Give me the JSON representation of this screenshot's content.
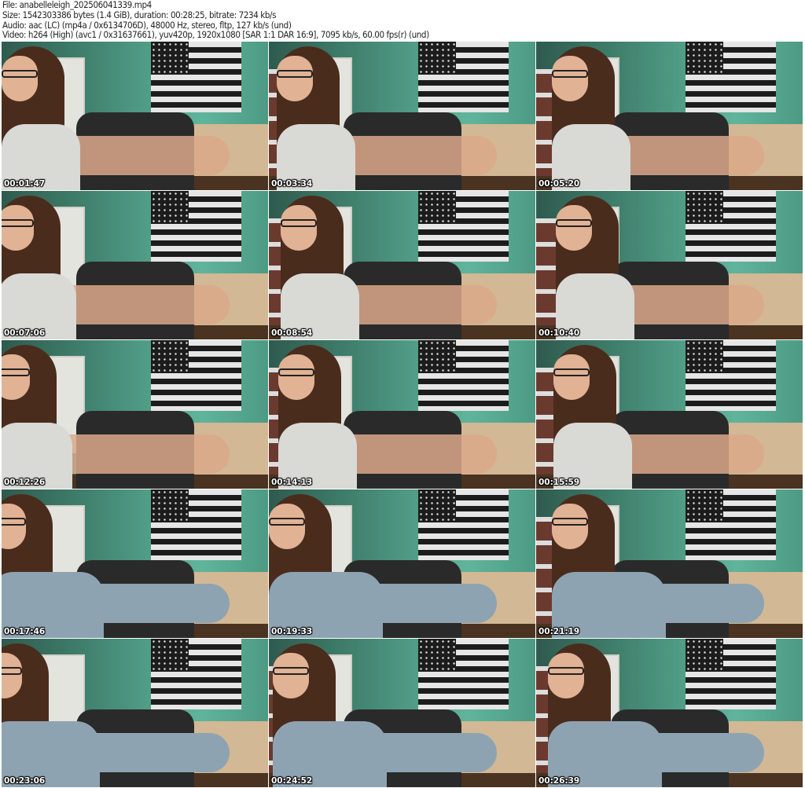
{
  "header": {
    "file": "File: anabelleleigh_202506041339.mp4",
    "size": "Size: 1542303386 bytes (1.4 GiB), duration: 00:28:25, bitrate: 7234 kb/s",
    "audio": "Audio: aac (LC) (mp4a / 0x6134706D), 48000 Hz, stereo, fltp, 127 kb/s (und)",
    "video": "Video: h264 (High) (avc1 / 0x31637661), yuv420p, 1920x1080 [SAR 1:1 DAR 16:9], 7095 kb/s, 60.00 fps(r) (und)"
  },
  "thumbnails": [
    {
      "timestamp": "00:01:47",
      "outfit": "white"
    },
    {
      "timestamp": "00:03:34",
      "outfit": "white"
    },
    {
      "timestamp": "00:05:20",
      "outfit": "white"
    },
    {
      "timestamp": "00:07:06",
      "outfit": "white"
    },
    {
      "timestamp": "00:08:54",
      "outfit": "white"
    },
    {
      "timestamp": "00:10:40",
      "outfit": "white"
    },
    {
      "timestamp": "00:12:26",
      "outfit": "white"
    },
    {
      "timestamp": "00:14:13",
      "outfit": "white"
    },
    {
      "timestamp": "00:15:59",
      "outfit": "white"
    },
    {
      "timestamp": "00:17:46",
      "outfit": "sweat"
    },
    {
      "timestamp": "00:19:33",
      "outfit": "sweat"
    },
    {
      "timestamp": "00:21:19",
      "outfit": "sweat"
    },
    {
      "timestamp": "00:23:06",
      "outfit": "sweat"
    },
    {
      "timestamp": "00:24:52",
      "outfit": "sweat"
    },
    {
      "timestamp": "00:26:39",
      "outfit": "sweat"
    }
  ]
}
